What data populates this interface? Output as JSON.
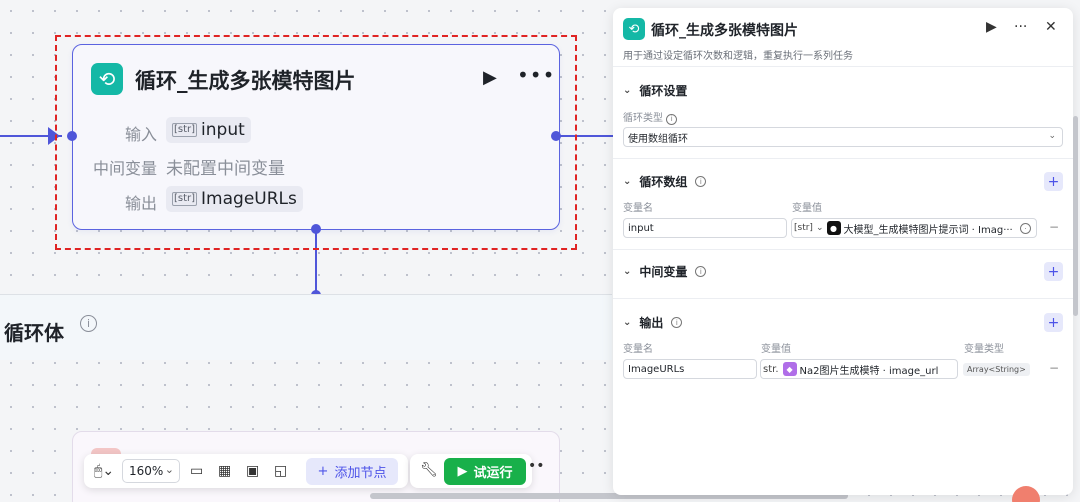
{
  "loop_node": {
    "title": "循环_生成多张模特图片",
    "icon": "loop-icon",
    "input_label": "输入",
    "input_type": "[str]",
    "input_value": "input",
    "intermediate_label": "中间变量",
    "intermediate_value": "未配置中间变量",
    "output_label": "输出",
    "output_type": "[str]",
    "output_value": "ImageURLs"
  },
  "loop_body": {
    "title": "循环体"
  },
  "toolbar": {
    "zoom": "160%",
    "add_node": "添加节点",
    "test_run": "试运行"
  },
  "panel": {
    "title": "循环_生成多张模特图片",
    "description": "用于通过设定循环次数和逻辑，重复执行一系列任务",
    "loop_settings": {
      "title": "循环设置",
      "type_label": "循环类型",
      "type_value": "使用数组循环"
    },
    "loop_array": {
      "title": "循环数组",
      "col_name": "变量名",
      "col_value": "变量值",
      "name_value": "input",
      "value_type": "[str]",
      "value_ref": "大模型_生成模特图片提示词 · Imag···"
    },
    "intermediate": {
      "title": "中间变量"
    },
    "output": {
      "title": "输出",
      "col_name": "变量名",
      "col_value": "变量值",
      "col_type": "变量类型",
      "name_value": "ImageURLs",
      "value_type": "str.",
      "value_ref": "Na2图片生成模特 · image_url",
      "type_value": "Array<String>"
    }
  },
  "colors": {
    "accent": "#4d53e8",
    "edge": "#4f56d9",
    "loop_icon": "#14b8a6",
    "run_green": "#18b04a",
    "highlight": "#e02424"
  }
}
